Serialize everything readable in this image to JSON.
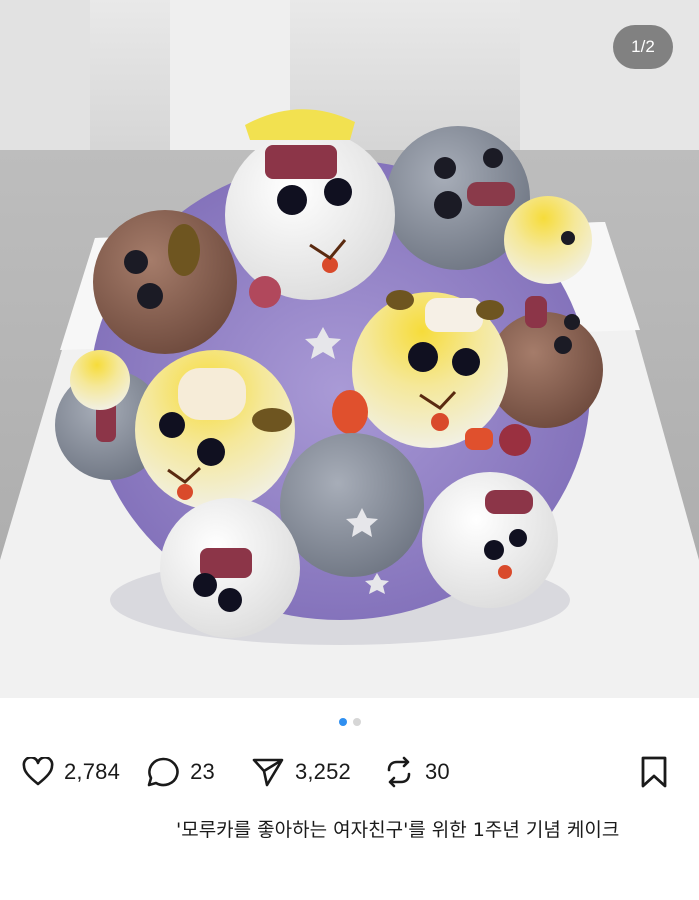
{
  "post": {
    "image_alt_icon": "cake-photo",
    "page_indicator": "1/2",
    "dots": [
      {
        "active": true,
        "color": "#2f8ff0"
      },
      {
        "active": false,
        "color": "#d6d6d6"
      }
    ]
  },
  "actions": {
    "like": {
      "icon": "heart-icon",
      "count": "2,784"
    },
    "comment": {
      "icon": "speech-bubble-icon",
      "count": "23"
    },
    "share": {
      "icon": "paper-plane-icon",
      "count": "3,252"
    },
    "repost": {
      "icon": "repost-icon",
      "count": "30"
    },
    "bookmark": {
      "icon": "bookmark-icon"
    }
  },
  "caption": {
    "text": "'모루카를 좋아하는 여자친구'를 위한 1주년 기념 케이크"
  },
  "colors": {
    "text": "#1a1a1a",
    "accent_dot": "#2f8ff0"
  }
}
